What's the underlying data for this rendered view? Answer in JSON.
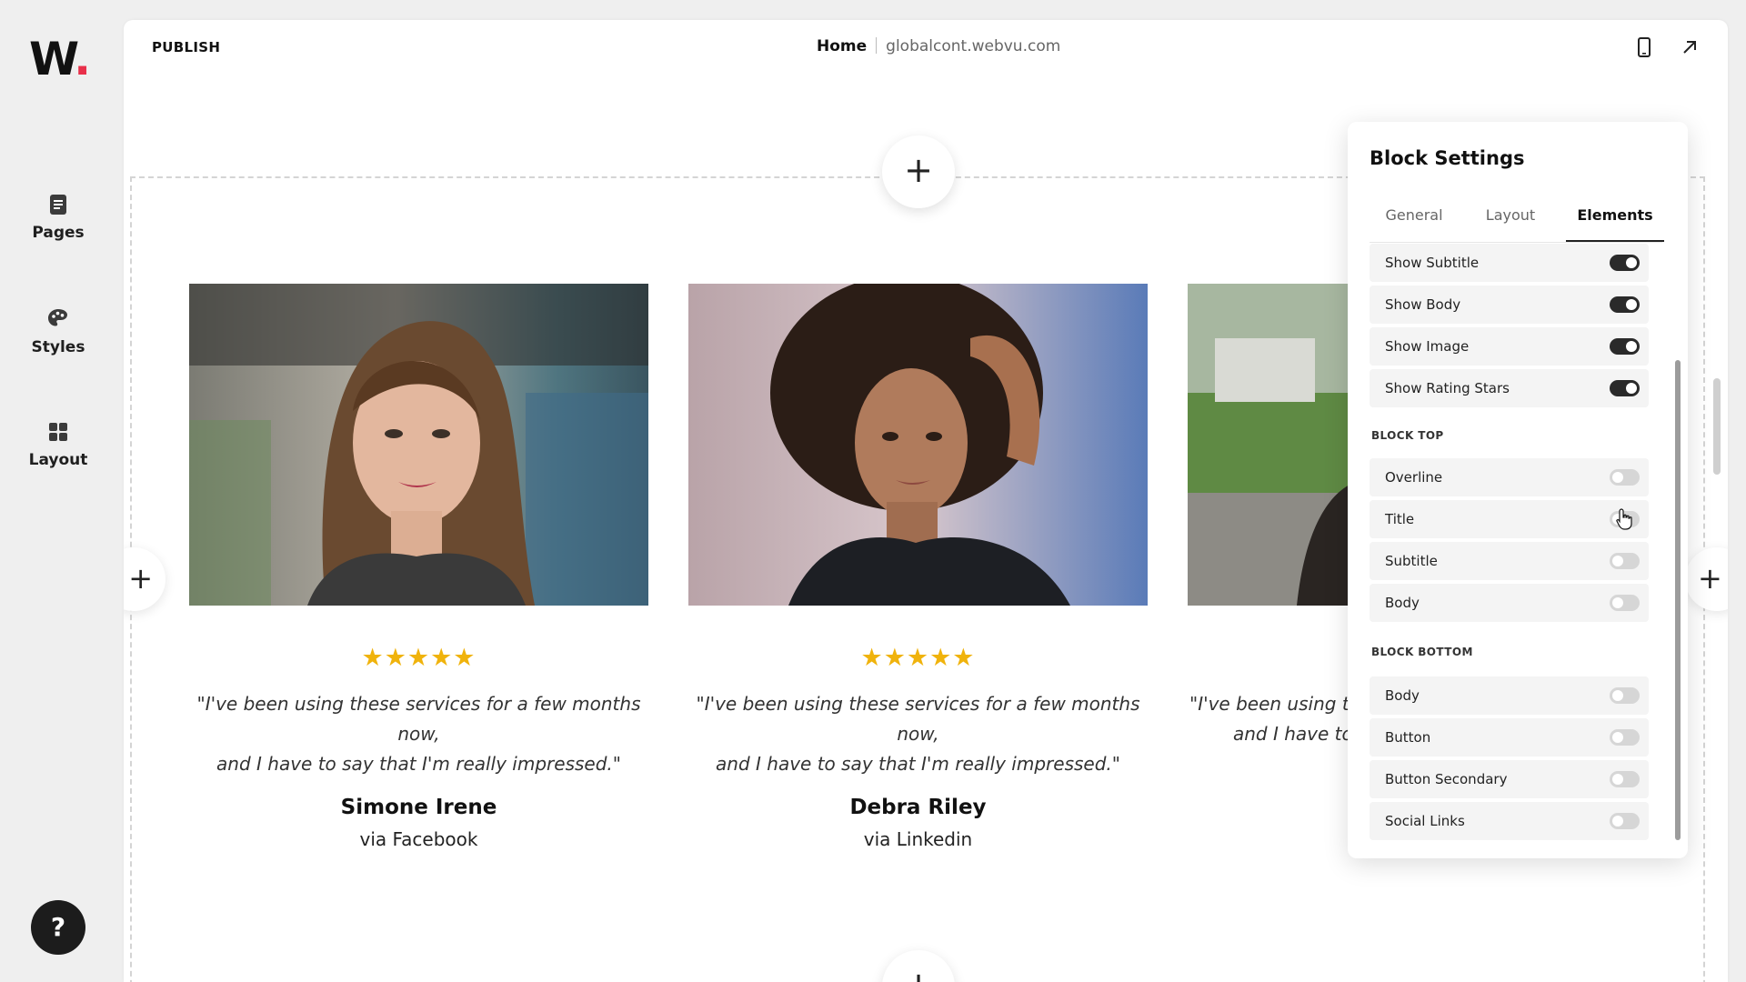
{
  "app": {
    "logo_text": "W",
    "logo_dot": "."
  },
  "sidebar": {
    "items": [
      {
        "label": "Pages",
        "icon": "pages-icon"
      },
      {
        "label": "Styles",
        "icon": "palette-icon"
      },
      {
        "label": "Layout",
        "icon": "layout-grid-icon"
      }
    ],
    "help_label": "?"
  },
  "topbar": {
    "publish_label": "PUBLISH",
    "home_label": "Home",
    "url": "globalcont.webvu.com",
    "icons": [
      "mobile-preview-icon",
      "open-external-icon"
    ]
  },
  "canvas": {
    "add_label": "+",
    "stars": "★★★★★",
    "testimonials": [
      {
        "quote_line1": "\"I've been using these services for a few months now,",
        "quote_line2": "and I have to say that I'm really impressed.\"",
        "name": "Simone Irene",
        "source": "via Facebook",
        "rating": 5
      },
      {
        "quote_line1": "\"I've been using these services for a few months now,",
        "quote_line2": "and I have to say that I'm really impressed.\"",
        "name": "Debra Riley",
        "source": "via Linkedin",
        "rating": 5
      },
      {
        "quote_line1": "\"I've been using the",
        "quote_line2": "and I have to",
        "name": "",
        "source": "",
        "rating": 0
      }
    ]
  },
  "panel": {
    "title": "Block Settings",
    "tabs": [
      "General",
      "Layout",
      "Elements"
    ],
    "active_tab": "Elements",
    "item_rows": [
      {
        "label": "Show Subtitle",
        "on": true
      },
      {
        "label": "Show Body",
        "on": true
      },
      {
        "label": "Show Image",
        "on": true
      },
      {
        "label": "Show Rating Stars",
        "on": true
      }
    ],
    "block_top_heading": "BLOCK TOP",
    "block_top_rows": [
      {
        "label": "Overline",
        "on": false
      },
      {
        "label": "Title",
        "on": false
      },
      {
        "label": "Subtitle",
        "on": false
      },
      {
        "label": "Body",
        "on": false
      }
    ],
    "block_bottom_heading": "BLOCK BOTTOM",
    "block_bottom_rows": [
      {
        "label": "Body",
        "on": false
      },
      {
        "label": "Button",
        "on": false
      },
      {
        "label": "Button Secondary",
        "on": false
      },
      {
        "label": "Social Links",
        "on": false
      }
    ]
  },
  "colors": {
    "star": "#f0b30c",
    "logo_dot": "#e8304a",
    "toggle_on": "#2a2a2a",
    "toggle_off": "#d6d6d6"
  }
}
